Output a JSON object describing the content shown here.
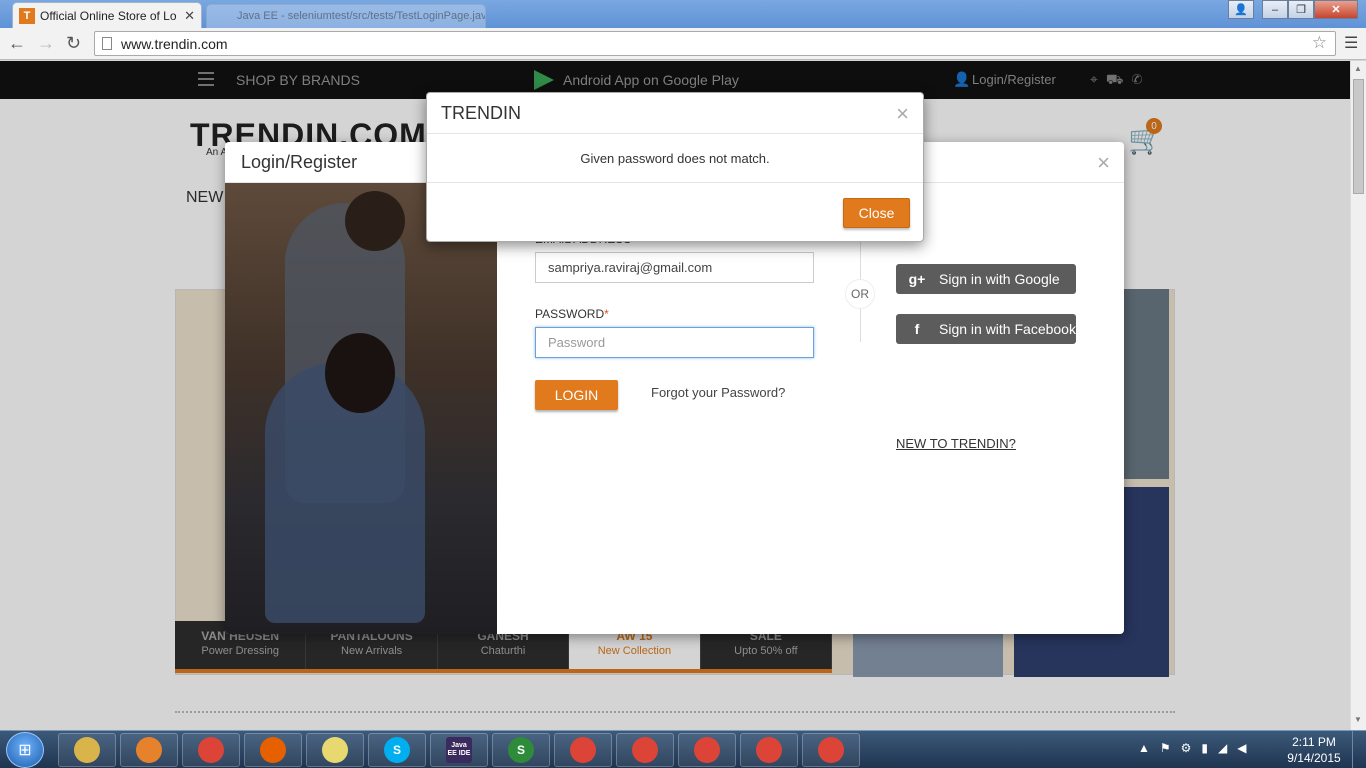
{
  "browser": {
    "tab_title": "Official Online Store of Lo",
    "tab_favicon": "T",
    "inactive_tab_title": "Java EE - seleniumtest/src/tests/TestLoginPage.java - Eclipse",
    "url": "www.trendin.com",
    "window_buttons": [
      "–",
      "❐",
      "✕"
    ]
  },
  "site": {
    "shop_by_brands": "SHOP BY BRANDS",
    "android_app": "Android App on Google Play",
    "login_register": "Login/Register",
    "logo": "TRENDIN.COM",
    "logo_sub": "An A",
    "cart_count": "0",
    "nav_new": "NEW",
    "strip": [
      {
        "title": "VAN HEUSEN",
        "sub": "Power Dressing"
      },
      {
        "title": "PANTALOONS",
        "sub": "New Arrivals"
      },
      {
        "title": "GANESH",
        "sub": "Chaturthi"
      },
      {
        "title": "AW 15",
        "sub": "New Collection"
      },
      {
        "title": "SALE",
        "sub": "Upto 50% off"
      }
    ]
  },
  "login_modal": {
    "title": "Login/Register",
    "close_glyph": "×",
    "email_label": "EMAIL ADDRESS",
    "email_value": "sampriya.raviraj@gmail.com",
    "password_label": "PASSWORD",
    "required_mark": "*",
    "password_placeholder": "Password",
    "login_button": "LOGIN",
    "forgot_password": "Forgot your Password?",
    "or_text": "OR",
    "google_icon": "g+",
    "google_button": "Sign in with Google",
    "facebook_icon": "f",
    "facebook_button": "Sign in with Facebook",
    "new_to": "NEW TO TRENDIN?"
  },
  "alert": {
    "title": "TRENDIN",
    "close_glyph": "×",
    "message": "Given password does not match.",
    "close_button": "Close"
  },
  "taskbar": {
    "time": "2:11 PM",
    "date": "9/14/2015",
    "apps": [
      {
        "icon": "folder-icon",
        "label": "",
        "color": "#d9b44a"
      },
      {
        "icon": "media-player-icon",
        "label": "",
        "color": "#e6822c"
      },
      {
        "icon": "chrome-icon",
        "label": "",
        "color": "#db4437"
      },
      {
        "icon": "firefox-icon",
        "label": "",
        "color": "#e66000"
      },
      {
        "icon": "sticky-notes-icon",
        "label": "",
        "color": "#e8d870"
      },
      {
        "icon": "skype-icon",
        "label": "S",
        "color": "#00aff0"
      },
      {
        "icon": "java-ee-ide-icon",
        "label": "Java EE IDE",
        "color": "#3b2a5e"
      },
      {
        "icon": "spreadsheet-icon",
        "label": "S",
        "color": "#2e8b3a"
      },
      {
        "icon": "chrome-icon",
        "label": "",
        "color": "#db4437"
      },
      {
        "icon": "chrome-icon",
        "label": "",
        "color": "#db4437"
      },
      {
        "icon": "chrome-icon",
        "label": "",
        "color": "#db4437"
      },
      {
        "icon": "chrome-icon",
        "label": "",
        "color": "#db4437"
      },
      {
        "icon": "chrome-icon",
        "label": "",
        "color": "#db4437"
      }
    ]
  },
  "colors": {
    "accent": "#e07a1c",
    "social_button": "#5c5c5c"
  }
}
